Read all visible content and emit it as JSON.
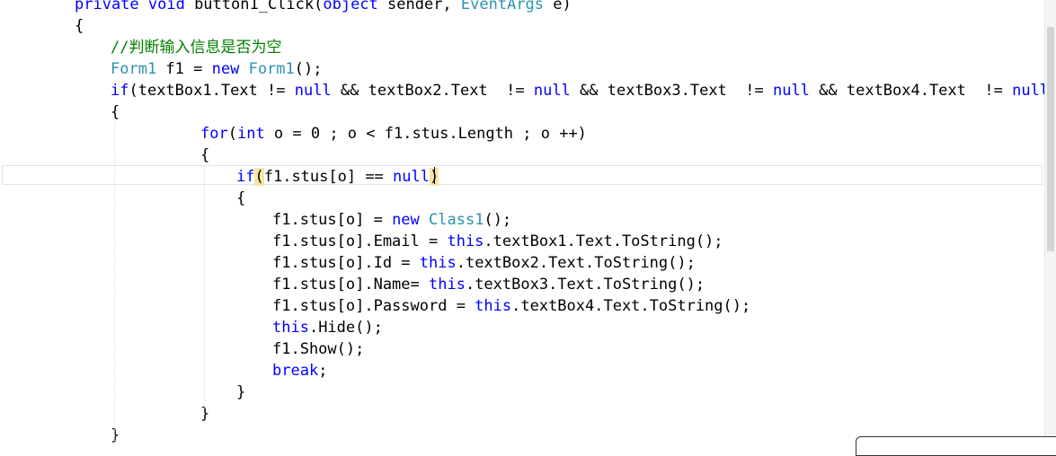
{
  "editor": {
    "lines": [
      {
        "tokens": [
          {
            "t": "private void",
            "c": "kw"
          },
          {
            "t": " button1_Click(",
            "c": "tx"
          },
          {
            "t": "object",
            "c": "kw"
          },
          {
            "t": " sender, ",
            "c": "tx"
          },
          {
            "t": "EventArgs",
            "c": "tp"
          },
          {
            "t": " e)",
            "c": "tx"
          }
        ]
      },
      {
        "tokens": [
          {
            "t": "{",
            "c": "tx"
          }
        ]
      },
      {
        "tokens": [
          {
            "t": "//判断输入信息是否为空",
            "c": "cm"
          }
        ]
      },
      {
        "tokens": [
          {
            "t": "Form1",
            "c": "tp"
          },
          {
            "t": " f1 = ",
            "c": "tx"
          },
          {
            "t": "new",
            "c": "kw"
          },
          {
            "t": " ",
            "c": "tx"
          },
          {
            "t": "Form1",
            "c": "tp"
          },
          {
            "t": "();",
            "c": "tx"
          }
        ]
      },
      {
        "tokens": [
          {
            "t": "if",
            "c": "kw"
          },
          {
            "t": "(textBox1.Text != ",
            "c": "tx"
          },
          {
            "t": "null",
            "c": "kw"
          },
          {
            "t": " && textBox2.Text  != ",
            "c": "tx"
          },
          {
            "t": "null",
            "c": "kw"
          },
          {
            "t": " && textBox3.Text  != ",
            "c": "tx"
          },
          {
            "t": "null",
            "c": "kw"
          },
          {
            "t": " && textBox4.Text  != ",
            "c": "tx"
          },
          {
            "t": "null",
            "c": "kw"
          },
          {
            "t": " & ",
            "c": "tx"
          },
          {
            "t": "(",
            "c": "hl"
          }
        ]
      },
      {
        "tokens": [
          {
            "t": "{",
            "c": "tx"
          }
        ]
      },
      {
        "tokens": [
          {
            "t": "for",
            "c": "kw"
          },
          {
            "t": "(",
            "c": "tx"
          },
          {
            "t": "int",
            "c": "kw"
          },
          {
            "t": " o = 0 ; o < f1.stus.Length ; o ++)",
            "c": "tx"
          }
        ]
      },
      {
        "tokens": [
          {
            "t": "{",
            "c": "tx"
          }
        ]
      },
      {
        "tokens": [
          {
            "t": "if",
            "c": "kw"
          },
          {
            "t": "(",
            "c": "hl"
          },
          {
            "t": "f1.stus[o] == ",
            "c": "tx"
          },
          {
            "t": "null",
            "c": "kw"
          },
          {
            "t": ")",
            "c": "hl"
          }
        ]
      },
      {
        "tokens": [
          {
            "t": "{",
            "c": "tx"
          }
        ]
      },
      {
        "tokens": [
          {
            "t": "f1.stus[o] = ",
            "c": "tx"
          },
          {
            "t": "new",
            "c": "kw"
          },
          {
            "t": " ",
            "c": "tx"
          },
          {
            "t": "Class1",
            "c": "tp"
          },
          {
            "t": "();",
            "c": "tx"
          }
        ]
      },
      {
        "tokens": [
          {
            "t": "f1.stus[o].Email = ",
            "c": "tx"
          },
          {
            "t": "this",
            "c": "kw"
          },
          {
            "t": ".textBox1.Text.ToString();",
            "c": "tx"
          }
        ]
      },
      {
        "tokens": [
          {
            "t": "f1.stus[o].Id = ",
            "c": "tx"
          },
          {
            "t": "this",
            "c": "kw"
          },
          {
            "t": ".textBox2.Text.ToString();",
            "c": "tx"
          }
        ]
      },
      {
        "tokens": [
          {
            "t": "f1.stus[o].Name= ",
            "c": "tx"
          },
          {
            "t": "this",
            "c": "kw"
          },
          {
            "t": ".textBox3.Text.ToString();",
            "c": "tx"
          }
        ]
      },
      {
        "tokens": [
          {
            "t": "f1.stus[o].Password = ",
            "c": "tx"
          },
          {
            "t": "this",
            "c": "kw"
          },
          {
            "t": ".textBox4.Text.ToString();",
            "c": "tx"
          }
        ]
      },
      {
        "tokens": [
          {
            "t": "this",
            "c": "kw"
          },
          {
            "t": ".Hide();",
            "c": "tx"
          }
        ]
      },
      {
        "tokens": [
          {
            "t": "f1.Show();",
            "c": "tx"
          }
        ]
      },
      {
        "tokens": [
          {
            "t": "break",
            "c": "kw"
          },
          {
            "t": ";",
            "c": "tx"
          }
        ]
      },
      {
        "tokens": [
          {
            "t": "}",
            "c": "tx"
          }
        ]
      },
      {
        "tokens": [
          {
            "t": "}",
            "c": "tx"
          }
        ]
      },
      {
        "tokens": [
          {
            "t": "}",
            "c": "tx"
          }
        ]
      }
    ]
  }
}
